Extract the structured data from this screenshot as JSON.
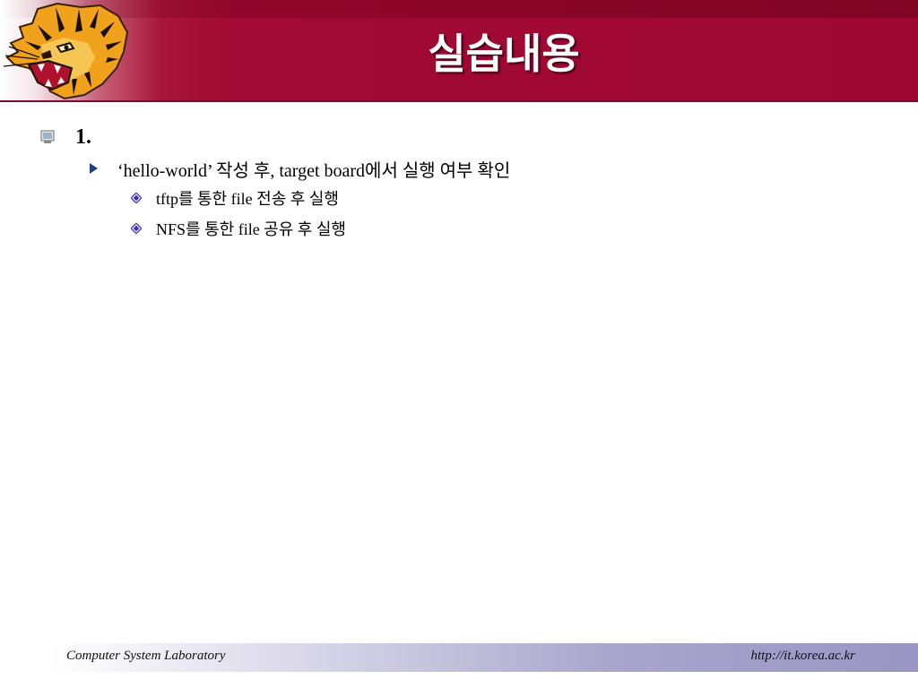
{
  "slide": {
    "title": "실습내용",
    "logo_icon": "tiger-head-icon"
  },
  "outline": {
    "level1": {
      "label": "1.",
      "bullet_icon": "monitor-bullet-icon"
    },
    "level2": {
      "label": "‘hello-world’ 작성 후, target board에서 실행 여부 확인",
      "bullet_icon": "triangle-bullet-icon"
    },
    "level3": [
      {
        "label": "tftp를 통한 file 전송 후 실행",
        "bullet_icon": "diamond-bullet-icon"
      },
      {
        "label": "NFS를 통한 file 공유 후 실행",
        "bullet_icon": "diamond-bullet-icon"
      }
    ]
  },
  "footer": {
    "left_text": "Computer System Laboratory",
    "right_text": "http://it.korea.ac.kr"
  },
  "colors": {
    "header": "#a10a34",
    "bullet_blue": "#1d3f86",
    "footer_band": "#9a95c4"
  }
}
